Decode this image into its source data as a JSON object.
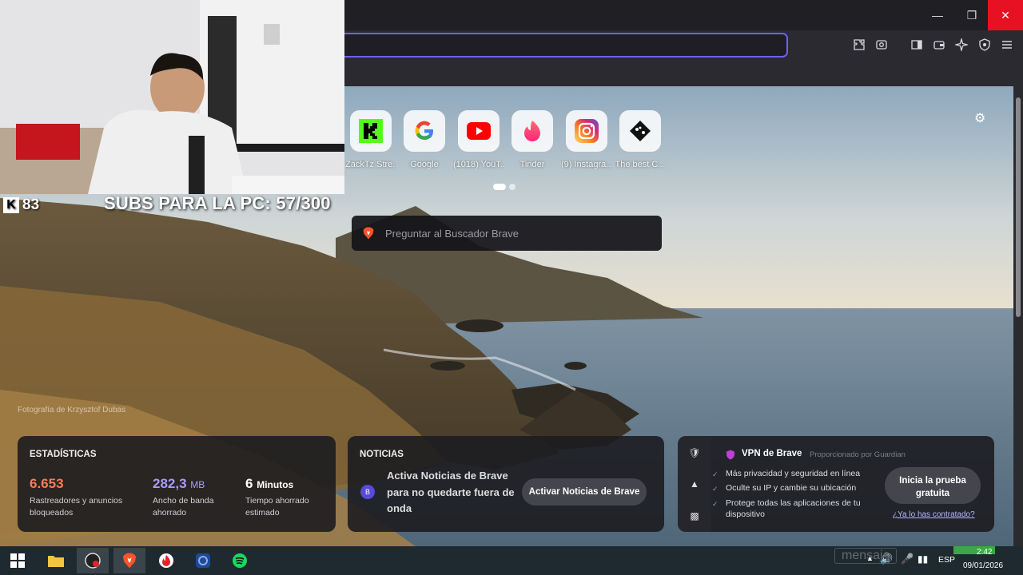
{
  "overlay": {
    "stream_count": "83",
    "subs_text": "SUBS PARA LA PC: 57/300"
  },
  "top_sites": [
    {
      "name": "ZackTz Stre...",
      "icon": "kick-icon",
      "color": "#53fc18"
    },
    {
      "name": "Google",
      "icon": "google-icon",
      "color": "#4285f4"
    },
    {
      "name": "(1018) YouT...",
      "icon": "youtube-icon",
      "color": "#ff0000"
    },
    {
      "name": "Tinder",
      "icon": "tinder-icon",
      "color": "#fe3c72"
    },
    {
      "name": "(9) Instagra...",
      "icon": "instagram-icon",
      "color": "#d62976"
    },
    {
      "name": "The best C...",
      "icon": "game-icon",
      "color": "#111111"
    }
  ],
  "search": {
    "placeholder": "Preguntar al Buscador Brave"
  },
  "photo_credit": "Fotografía de Krzysztof Dubas",
  "stats": {
    "title": "ESTADÍSTICAS",
    "trackers_value": "6.653",
    "trackers_label": "Rastreadores y anuncios bloqueados",
    "bandwidth_value": "282,3",
    "bandwidth_unit": "MB",
    "bandwidth_label": "Ancho de banda ahorrado",
    "time_value": "6",
    "time_unit": "Minutos",
    "time_label": "Tiempo ahorrado estimado"
  },
  "news": {
    "title": "NOTICIAS",
    "text": "Activa Noticias de Brave para no quedarte fuera de onda",
    "button": "Activar Noticias de Brave"
  },
  "vpn": {
    "title": "VPN de Brave",
    "provider": "Proporcionado por Guardian",
    "features": [
      "Más privacidad y seguridad en línea",
      "Oculte su IP y cambie su ubicación",
      "Protege todas las aplicaciones de tu dispositivo"
    ],
    "button": "Inicia la prueba gratuita",
    "link": "¿Ya lo has contratado?"
  },
  "taskbar": {
    "language": "ESP",
    "time": "2:42",
    "date": "09/01/2026",
    "ghost_text": "mensaje"
  },
  "colors": {
    "accent": "#6b63f5",
    "trackers": "#ff7a59",
    "bandwidth": "#a79bff",
    "close": "#e81123"
  }
}
